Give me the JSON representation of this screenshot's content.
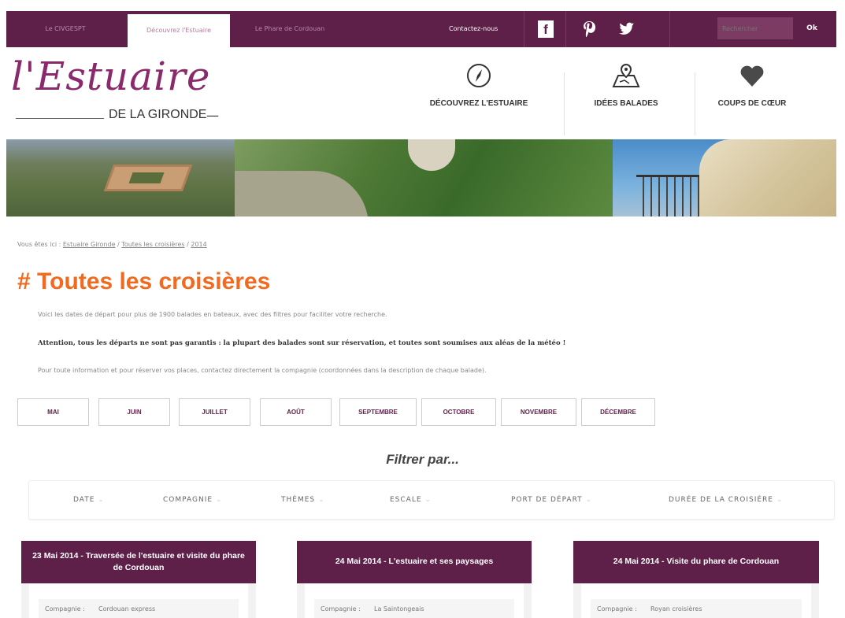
{
  "topbar": {
    "tabs": [
      {
        "label": "Le CIVGESPT",
        "active": false
      },
      {
        "label": "Découvrez l'Estuaire",
        "active": true
      },
      {
        "label": "Le Phare de Cordouan",
        "active": false
      }
    ],
    "contact_label": "Contactez-nous",
    "social": [
      {
        "icon": "facebook-icon",
        "glyph": "f"
      },
      {
        "icon": "pinterest-icon",
        "glyph": "℗"
      },
      {
        "icon": "twitter-icon",
        "glyph": "✦"
      }
    ],
    "search_placeholder": "Rechercher",
    "search_button": "Ok"
  },
  "logo": {
    "script": "l'Estuaire",
    "subtitle": "DE LA GIRONDE",
    "dash": "—"
  },
  "nav": [
    {
      "label": "DÉCOUVREZ L'ESTUAIRE",
      "icon": "compass-icon"
    },
    {
      "label": "IDÉES BALADES",
      "icon": "map-pin-icon"
    },
    {
      "label": "COUPS DE CŒUR",
      "icon": "heart-icon"
    }
  ],
  "breadcrumb": {
    "prefix": "Vous êtes ici :",
    "items": [
      "Estuaire Gironde",
      "Toutes les croisières",
      "2014"
    ],
    "separator": "/"
  },
  "page": {
    "title": "# Toutes les croisières",
    "intro": "Voici les dates de départ pour plus de 1900 balades en bateaux, avec des filtres pour faciliter votre recherche.",
    "warning": "Attention, tous les départs ne sont pas garantis : la plupart des balades sont sur réservation, et toutes sont soumises aux aléas de la météo !",
    "info": "Pour toute information et pour réserver vos places, contactez directement la compagnie (coordonnées dans la description de chaque balade)."
  },
  "months": [
    "MAI",
    "JUIN",
    "JUILLET",
    "AOÛT",
    "SEPTEMBRE",
    "OCTOBRE",
    "NOVEMBRE",
    "DÉCEMBRE"
  ],
  "filter": {
    "title": "Filtrer par...",
    "items": [
      "DATE",
      "COMPAGNIE",
      "THÈMES",
      "ESCALE",
      "PORT DE DÉPART",
      "DURÉE DE LA CROISIÈRE"
    ],
    "chevron": "⌄"
  },
  "cards": [
    {
      "title": "23 Mai 2014 - Traversée de l'estuaire et visite du phare de Cordouan",
      "company_label": "Compagnie :",
      "company": "Cordouan express"
    },
    {
      "title": "24 Mai 2014 - L'estuaire et ses paysages",
      "company_label": "Compagnie :",
      "company": "La Saintongeais"
    },
    {
      "title": "24 Mai 2014 - Visite du phare de Cordouan",
      "company_label": "Compagnie :",
      "company": "Royan croisières"
    }
  ],
  "colors": {
    "brand": "#5e1f48",
    "accent": "#f06a1f",
    "logo": "#8a2a6c"
  }
}
